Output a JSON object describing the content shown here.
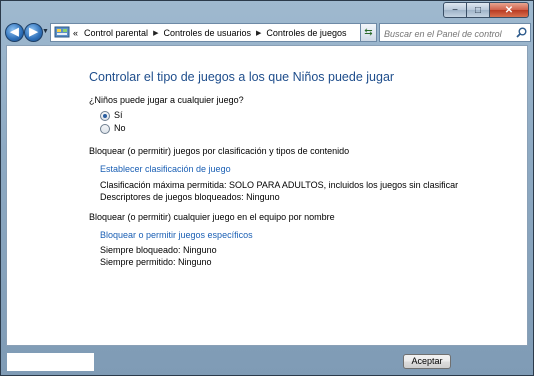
{
  "window": {
    "buttons": {
      "minimize": "−",
      "maximize": "□",
      "close": "✕"
    }
  },
  "nav": {
    "back": "◀",
    "forward": "▶",
    "overflow": "«",
    "breadcrumbs": [
      "Control parental",
      "Controles de usuarios",
      "Controles de juegos"
    ],
    "search_placeholder": "Buscar en el Panel de control"
  },
  "content": {
    "heading": "Controlar el tipo de juegos a los que Niños puede jugar",
    "question": "¿Niños puede jugar a cualquier juego?",
    "options": [
      {
        "label": "Sí",
        "checked": true
      },
      {
        "label": "No",
        "checked": false
      }
    ],
    "section_rating": {
      "heading": "Bloquear (o permitir) juegos por clasificación y tipos de contenido",
      "link": "Establecer clasificación de juego",
      "max_rating": "Clasificación máxima permitida:  SOLO PARA ADULTOS, incluidos los juegos sin clasificar",
      "blocked_descriptors": "Descriptores de juegos bloqueados:  Ninguno"
    },
    "section_name": {
      "heading": "Bloquear (o permitir) cualquier juego en el equipo por nombre",
      "link": "Bloquear o permitir juegos específicos",
      "always_blocked": "Siempre bloqueado:  Ninguno",
      "always_allowed": "Siempre permitido:  Ninguno"
    }
  },
  "footer": {
    "accept": "Aceptar"
  },
  "colors": {
    "heading": "#1f4e8c",
    "link": "#1a5fb4",
    "frame": "#8eaac3"
  }
}
